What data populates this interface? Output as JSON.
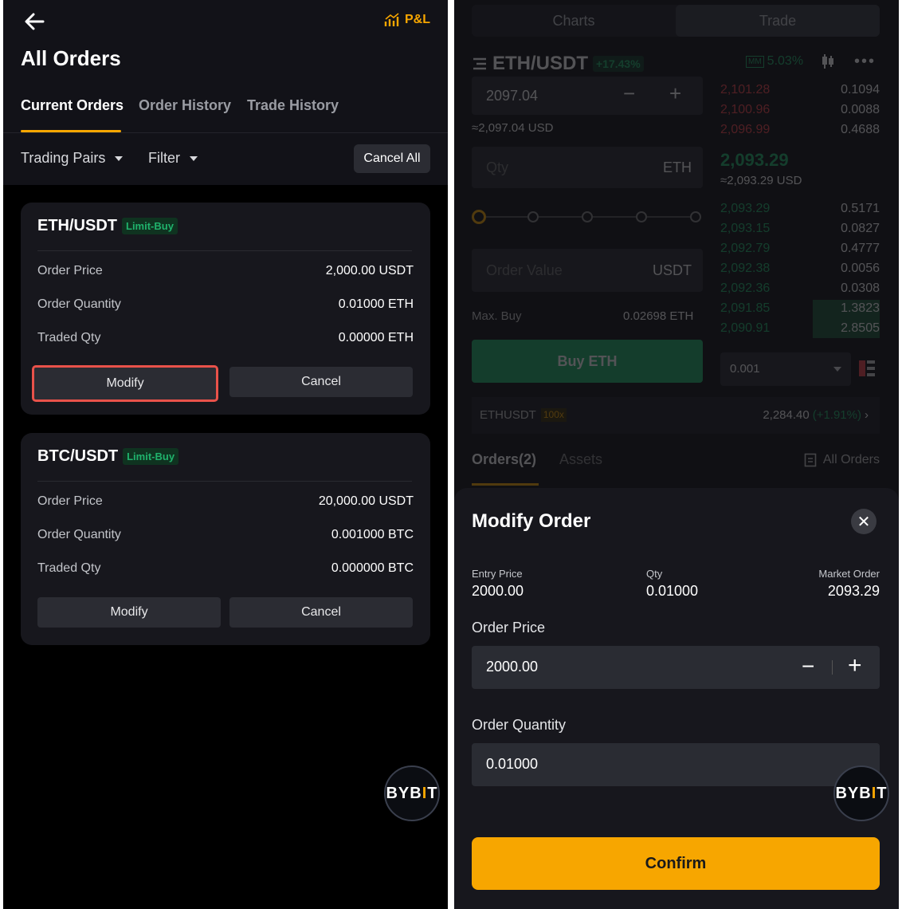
{
  "left": {
    "pnl_label": "P&L",
    "title": "All Orders",
    "tabs": [
      "Current Orders",
      "Order History",
      "Trade History"
    ],
    "filters": {
      "pairs": "Trading Pairs",
      "filter": "Filter"
    },
    "cancel_all": "Cancel All",
    "orders": [
      {
        "pair": "ETH/USDT",
        "badge": "Limit-Buy",
        "rows": [
          [
            "Order Price",
            "2,000.00 USDT"
          ],
          [
            "Order Quantity",
            "0.01000 ETH"
          ],
          [
            "Traded Qty",
            "0.00000 ETH"
          ]
        ],
        "modify": "Modify",
        "cancel": "Cancel"
      },
      {
        "pair": "BTC/USDT",
        "badge": "Limit-Buy",
        "rows": [
          [
            "Order Price",
            "20,000.00 USDT"
          ],
          [
            "Order Quantity",
            "0.001000 BTC"
          ],
          [
            "Traded Qty",
            "0.000000 BTC"
          ]
        ],
        "modify": "Modify",
        "cancel": "Cancel"
      }
    ],
    "logo": {
      "a": "BYB",
      "b": "I",
      "c": "T"
    }
  },
  "right": {
    "seg": [
      "Charts",
      "Trade"
    ],
    "pair": "ETH/USDT",
    "change": "+17.43%",
    "mm_badge": "MM",
    "mm_value": "5.03%",
    "price_input": "2097.04",
    "price_usd": "≈2,097.04 USD",
    "asks": [
      [
        "2,101.28",
        "0.1094"
      ],
      [
        "2,100.96",
        "0.0088"
      ],
      [
        "2,096.99",
        "0.4688"
      ]
    ],
    "last": "2,093.29",
    "last_usd": "≈2,093.29 USD",
    "bids": [
      [
        "2,093.29",
        "0.5171"
      ],
      [
        "2,093.15",
        "0.0827"
      ],
      [
        "2,092.79",
        "0.4777"
      ],
      [
        "2,092.38",
        "0.0056"
      ],
      [
        "2,092.36",
        "0.0308"
      ],
      [
        "2,091.85",
        "1.3823"
      ],
      [
        "2,090.91",
        "2.8505"
      ]
    ],
    "qty_placeholder": "Qty",
    "qty_unit": "ETH",
    "order_value": "Order Value",
    "order_value_unit": "USDT",
    "max_buy_label": "Max. Buy",
    "max_buy_value": "0.02698 ETH",
    "buy_btn": "Buy ETH",
    "step": "0.001",
    "perp_pair": "ETHUSDT",
    "perp_lev": "100x",
    "perp_price": "2,284.40",
    "perp_change": "(+1.91%)",
    "orders_tab": "Orders(2)",
    "assets_tab": "Assets",
    "all_orders": "All Orders",
    "modal": {
      "title": "Modify Order",
      "close": "✕",
      "entry_label": "Entry Price",
      "entry_value": "2000.00",
      "qty_label": "Qty",
      "qty_value": "0.01000",
      "market_label": "Market Order",
      "market_value": "2093.29",
      "price_label": "Order Price",
      "price_value": "2000.00",
      "quantity_label": "Order Quantity",
      "quantity_value": "0.01000",
      "confirm": "Confirm"
    },
    "logo": {
      "a": "BYB",
      "b": "I",
      "c": "T"
    }
  }
}
